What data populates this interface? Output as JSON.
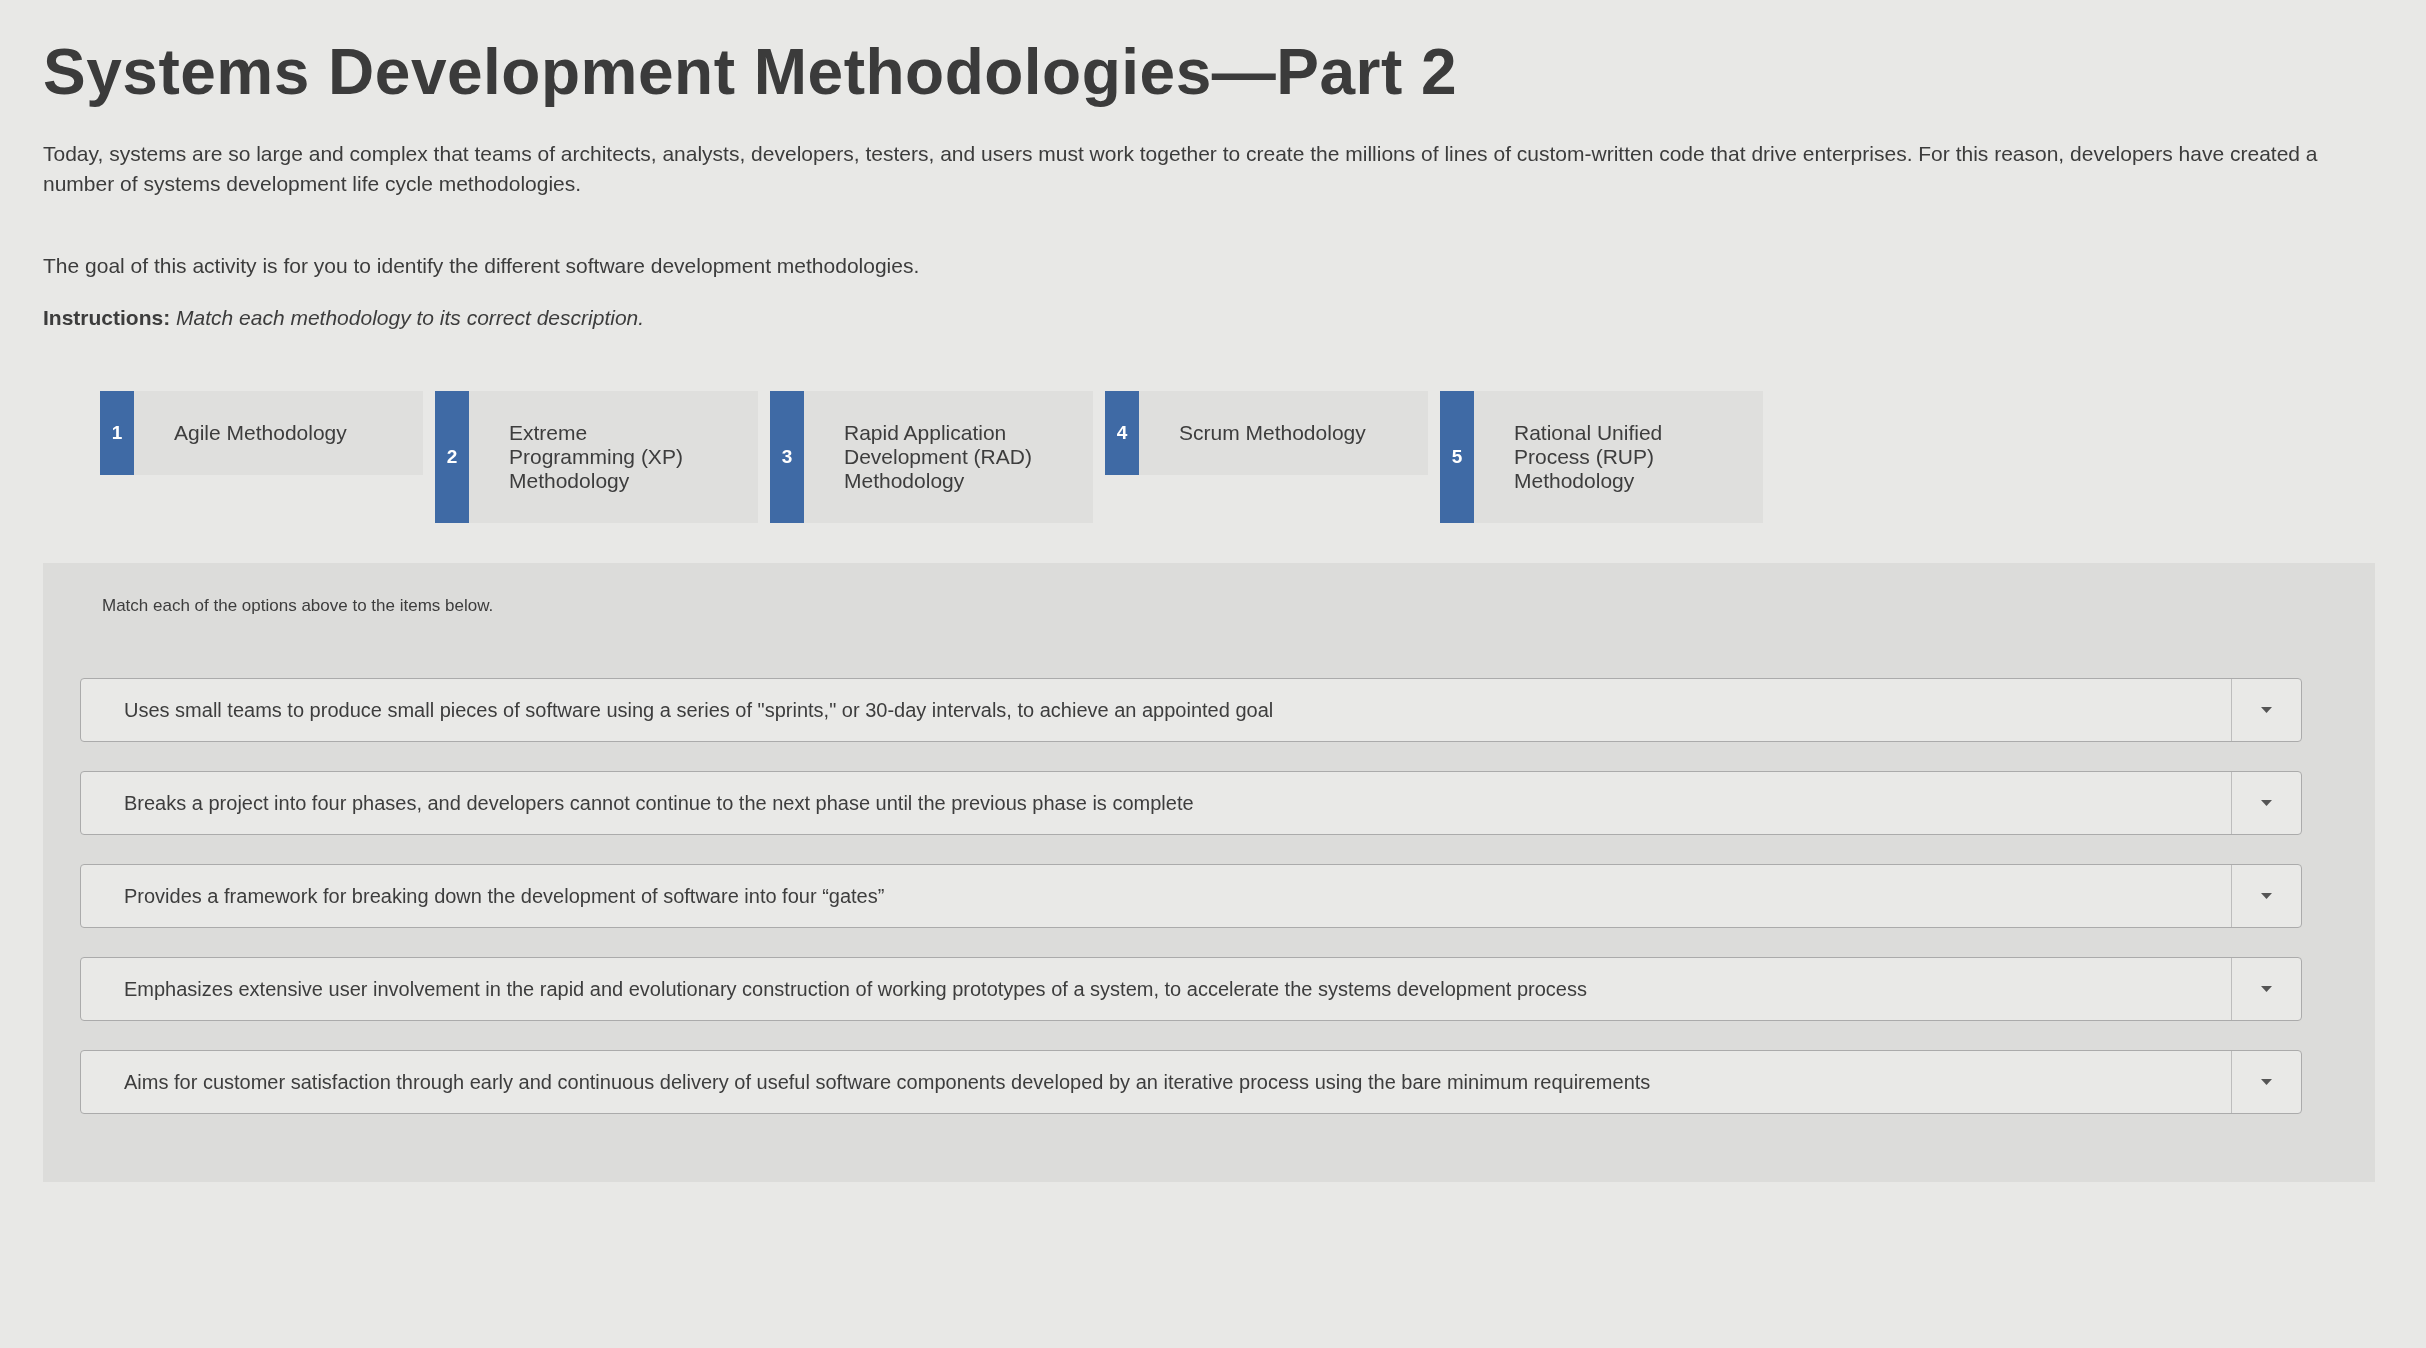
{
  "title": "Systems Development Methodologies—Part 2",
  "intro": [
    "Today, systems are so large and complex that teams of architects, analysts, developers, testers, and users must work together to create the millions of lines of custom-written code that drive enterprises. For this reason, developers have created a number of systems development life cycle methodologies.",
    "The goal of this activity is for you to identify the different software development methodologies."
  ],
  "instructions": "**Instructions:** *Match each methodology to its correct description.*",
  "options": [
    {
      "number": "1",
      "label": "Agile Methodology"
    },
    {
      "number": "2",
      "label": "Extreme Programming (XP) Methodology"
    },
    {
      "number": "3",
      "label": "Rapid Application Development (RAD) Methodology"
    },
    {
      "number": "4",
      "label": "Scrum Methodology"
    },
    {
      "number": "5",
      "label": "Rational Unified Process (RUP) Methodology"
    }
  ],
  "match_panel": {
    "prompt": "Match each of the options above to the items below.",
    "items": [
      {
        "description": "Uses small teams to produce small pieces of software using a series of \"sprints,\" or 30-day intervals, to achieve an appointed goal"
      },
      {
        "description": "Breaks a project into four phases, and developers cannot continue to the next phase until the previous phase is complete"
      },
      {
        "description": "Provides a framework for breaking down the development of software into four “gates”"
      },
      {
        "description": "Emphasizes extensive user involvement in the rapid and evolutionary construction of working prototypes of a system, to accelerate the systems development process"
      },
      {
        "description": "Aims for customer satisfaction through early and continuous delivery of useful software components developed by an iterative process using the bare minimum requirements"
      }
    ]
  }
}
